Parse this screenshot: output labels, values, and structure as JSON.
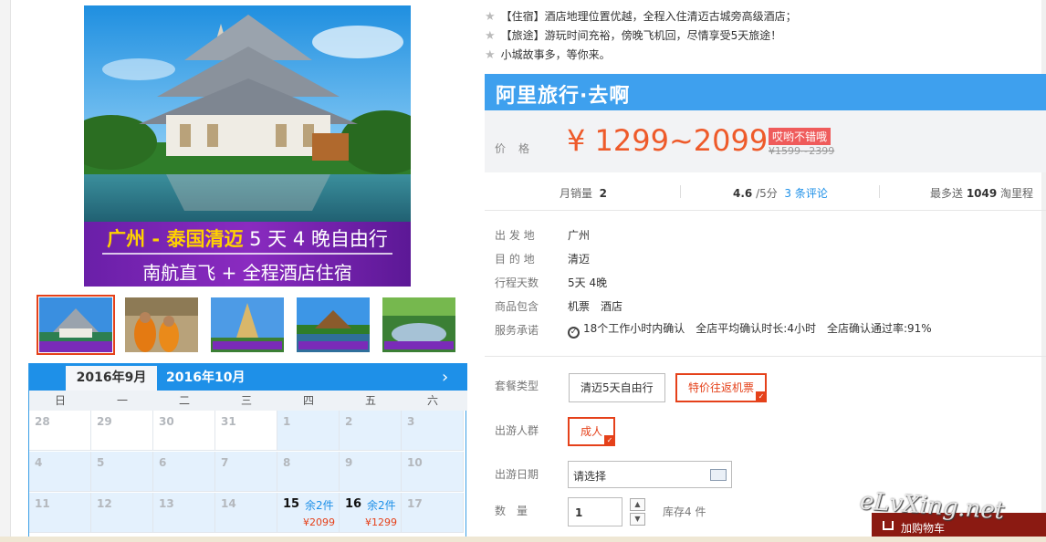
{
  "colors": {
    "accent_blue": "#1e90e8",
    "price_orange": "#ee5a2a",
    "select_red": "#e5411a",
    "cart_dark_red": "#8b1a12"
  },
  "main_image": {
    "line1_a": "广州 - ",
    "line1_b": "泰国清迈",
    "line1_c": " 5 天 4 晚",
    "line1_d": "自由行",
    "line2": "南航直飞 + 全程酒店住宿"
  },
  "thumbnails": [
    "thumb-temple",
    "thumb-monks",
    "thumb-pagoda",
    "thumb-lake",
    "thumb-garden"
  ],
  "calendar": {
    "tab_sep": "2016年9月",
    "tab_oct": "2016年10月",
    "next": "›",
    "weekdays": [
      "日",
      "一",
      "二",
      "三",
      "四",
      "五",
      "六"
    ],
    "rows": [
      [
        "28",
        "29",
        "30",
        "31",
        "1",
        "2",
        "3"
      ],
      [
        "4",
        "5",
        "6",
        "7",
        "8",
        "9",
        "10"
      ],
      [
        "11",
        "12",
        "13",
        "14",
        "15",
        "16",
        "17"
      ]
    ],
    "d15": {
      "stock": "余2件",
      "price": "¥2099"
    },
    "d16": {
      "stock": "余2件",
      "price": "¥1299"
    }
  },
  "highlights": [
    "【住宿】酒店地理位置优越，全程入住清迈古城旁高级酒店；",
    "【旅途】游玩时间充裕，傍晚飞机回，尽情享受5天旅途！",
    "小城故事多，等你来。"
  ],
  "brand": "阿里旅行·去啊",
  "price": {
    "label": "价格",
    "value": "¥ 1299~2099",
    "badge": "哎哟不错哦",
    "original": "¥1599~2399"
  },
  "stats": {
    "sales_label": "月销量",
    "sales_value": "2",
    "rating_value": "4.6",
    "rating_suffix": " /5分",
    "reviews_count": "3",
    "reviews_label": " 条评论",
    "points_label": "最多送 ",
    "points_value": "1049",
    "points_suffix": " 淘里程"
  },
  "attributes": {
    "departure_label": "出 发 地",
    "departure_value": "广州",
    "destination_label": "目 的 地",
    "destination_value": "清迈",
    "duration_label": "行程天数",
    "duration_value": "5天 4晚",
    "includes_label": "商品包含",
    "includes_a": "机票",
    "includes_b": "酒店",
    "promise_label": "服务承诺",
    "promise_a": "18个工作小时内确认",
    "promise_b": "全店平均确认时长:4小时",
    "promise_c": "全店确认通过率:91%"
  },
  "options": {
    "package_label": "套餐类型",
    "package_a": "清迈5天自由行",
    "package_b": "特价往返机票",
    "traveler_label": "出游人群",
    "traveler_a": "成人",
    "date_label": "出游日期",
    "date_value": "请选择",
    "qty_label": "数　量",
    "qty_value": "1",
    "stock": "库存4 件"
  },
  "cart_label": "加购物车",
  "watermark": "eLvXing.net"
}
